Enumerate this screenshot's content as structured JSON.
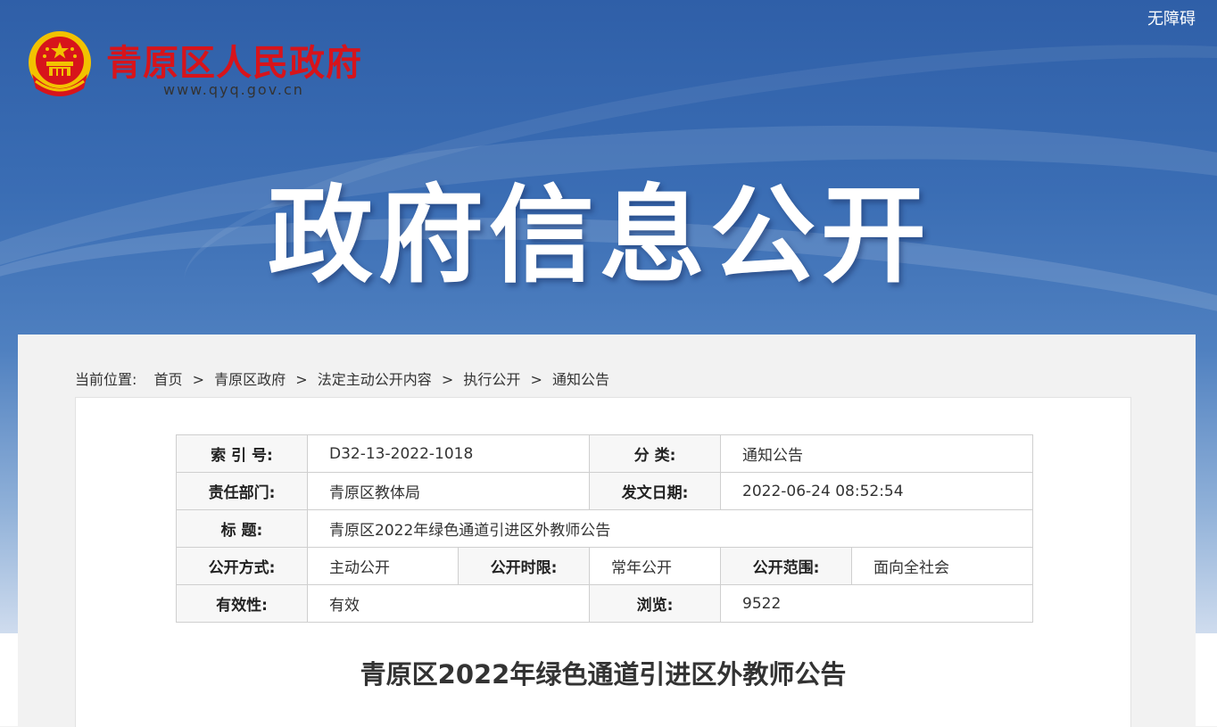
{
  "header": {
    "site_name": "青原区人民政府",
    "site_url": "www.qyq.gov.cn",
    "accessibility_label": "无障碍",
    "hero_title": "政府信息公开"
  },
  "breadcrumb": {
    "lead": "当前位置:",
    "items": [
      "首页",
      "青原区政府",
      "法定主动公开内容",
      "执行公开",
      "通知公告"
    ],
    "separator": ">"
  },
  "meta": {
    "index_label": "索 引 号:",
    "index_value": "D32-13-2022-1018",
    "category_label": "分 类:",
    "category_value": "通知公告",
    "dept_label": "责任部门:",
    "dept_value": "青原区教体局",
    "date_label": "发文日期:",
    "date_value": "2022-06-24 08:52:54",
    "title_label": "标 题:",
    "title_value": "青原区2022年绿色通道引进区外教师公告",
    "method_label": "公开方式:",
    "method_value": "主动公开",
    "period_label": "公开时限:",
    "period_value": "常年公开",
    "scope_label": "公开范围:",
    "scope_value": "面向全社会",
    "validity_label": "有效性:",
    "validity_value": "有效",
    "views_label": "浏览:",
    "views_value": "9522"
  },
  "document": {
    "title": "青原区2022年绿色通道引进区外教师公告"
  },
  "colors": {
    "brand_red": "#d7141b",
    "banner_blue": "#2f5fa8",
    "emblem_gold": "#f2c200"
  }
}
